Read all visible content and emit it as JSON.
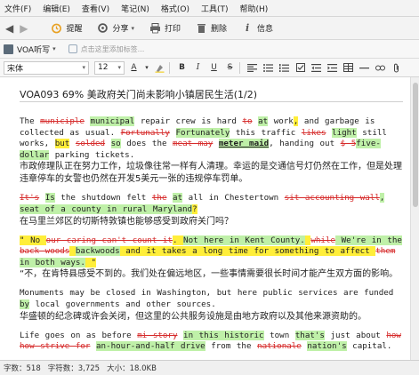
{
  "menu": [
    "文件(F)",
    "编辑(E)",
    "查看(V)",
    "笔记(N)",
    "格式(O)",
    "工具(T)",
    "帮助(H)"
  ],
  "toolbar": {
    "back": "◀",
    "forward": "▶",
    "remind": "提醒",
    "share": "分享",
    "share_arrow": "▾",
    "print": "打印",
    "delete": "删除",
    "info": "信息"
  },
  "notebook": {
    "name": "VOA听写",
    "arrow": "▾",
    "tag_placeholder": "点击这里添加标签..."
  },
  "format": {
    "font": "宋体",
    "size": "12",
    "color_btn": "A",
    "bold": "B",
    "italic": "I",
    "underline": "U",
    "strike": "S",
    "arrow": "▾"
  },
  "note": {
    "title": "VOA093 69% 美政府关门尚未影响小镇居民生活(1/2)",
    "paragraphs": [
      {
        "en": [
          {
            "t": "The ",
            "s": "n"
          },
          {
            "t": "municiple",
            "s": "del"
          },
          {
            "t": " ",
            "s": "n"
          },
          {
            "t": "municipal",
            "s": "hl"
          },
          {
            "t": " repair crew is hard ",
            "s": "n"
          },
          {
            "t": "to",
            "s": "del"
          },
          {
            "t": " ",
            "s": "n"
          },
          {
            "t": "at",
            "s": "hl"
          },
          {
            "t": " work",
            "s": "n"
          },
          {
            "t": ",",
            "s": "yl"
          },
          {
            "t": " and garbage is collected as usual. ",
            "s": "n"
          },
          {
            "t": "Fortunally",
            "s": "del"
          },
          {
            "t": " ",
            "s": "n"
          },
          {
            "t": "Fortunately",
            "s": "hl"
          },
          {
            "t": " this traffic ",
            "s": "n"
          },
          {
            "t": "likes",
            "s": "del"
          },
          {
            "t": " ",
            "s": "n"
          },
          {
            "t": "light",
            "s": "hl"
          },
          {
            "t": " still works, ",
            "s": "n"
          },
          {
            "t": "but",
            "s": "yl"
          },
          {
            "t": " ",
            "s": "n"
          },
          {
            "t": "solded",
            "s": "del"
          },
          {
            "t": " ",
            "s": "n"
          },
          {
            "t": "so",
            "s": "hl"
          },
          {
            "t": " does the ",
            "s": "n"
          },
          {
            "t": "meat may",
            "s": "del"
          },
          {
            "t": " ",
            "s": "n"
          },
          {
            "t": "meter maid",
            "s": "b"
          },
          {
            "t": ", handing out ",
            "s": "n"
          },
          {
            "t": "$ 5",
            "s": "del"
          },
          {
            "t": "five-dollar",
            "s": "hl"
          },
          {
            "t": " parking tickets.",
            "s": "n"
          }
        ],
        "cn": "市政修理队正在努力工作，垃圾像往常一样有人清理。幸运的是交通信号灯仍然在工作，但是处理违章停车的女警也仍然在开发5美元一张的违规停车罚单。"
      },
      {
        "en": [
          {
            "t": "It's",
            "s": "del"
          },
          {
            "t": " ",
            "s": "n"
          },
          {
            "t": "Is",
            "s": "hl"
          },
          {
            "t": " the shutdown felt ",
            "s": "n"
          },
          {
            "t": "the",
            "s": "del"
          },
          {
            "t": " ",
            "s": "n"
          },
          {
            "t": "at",
            "s": "hl"
          },
          {
            "t": " all in Chestertown ",
            "s": "n"
          },
          {
            "t": "sit accounting wall",
            "s": "del"
          },
          {
            "t": ", seat of a county in rural Maryland",
            "s": "hl"
          },
          {
            "t": "?",
            "s": "yl"
          }
        ],
        "cn": "在马里兰郊区的切斯特敦镇也能够感受到政府关门吗？"
      },
      {
        "en": [
          {
            "t": "\" No ",
            "s": "yl"
          },
          {
            "t": "our caring can't count it",
            "s": "del"
          },
          {
            "t": ". ",
            "s": "yl"
          },
          {
            "t": "Not here in Kent County.",
            "s": "hl"
          },
          {
            "t": " ",
            "s": "yl"
          },
          {
            "t": "while",
            "s": "del"
          },
          {
            "t": " We're in the ",
            "s": "hl"
          },
          {
            "t": "back woods",
            "s": "del"
          },
          {
            "t": " ",
            "s": "yl"
          },
          {
            "t": "backwoods",
            "s": "hl"
          },
          {
            "t": " and it takes a long time for something to affect ",
            "s": "yl"
          },
          {
            "t": "them",
            "s": "del"
          },
          {
            "t": " ",
            "s": "yl"
          },
          {
            "t": "in both ways.",
            "s": "hl"
          },
          {
            "t": " \"",
            "s": "yl"
          }
        ],
        "cn": "“不，在肯特县感受不到的。我们处在偏远地区，一些事情需要很长时间才能产生双方面的影响。"
      },
      {
        "en": [
          {
            "t": "Monuments may be closed in Washington, but here public services are funded ",
            "s": "n"
          },
          {
            "t": "by",
            "s": "hl"
          },
          {
            "t": " local governments and other sources.",
            "s": "n"
          }
        ],
        "cn": "华盛顿的纪念碑或许会关闭，但这里的公共服务设施是由地方政府以及其他来源资助的。"
      },
      {
        "en": [
          {
            "t": "Life goes on as before ",
            "s": "n"
          },
          {
            "t": "mi story",
            "s": "del"
          },
          {
            "t": " ",
            "s": "n"
          },
          {
            "t": "in this historic",
            "s": "hl"
          },
          {
            "t": " town ",
            "s": "n"
          },
          {
            "t": "that's",
            "s": "hl"
          },
          {
            "t": " just about ",
            "s": "n"
          },
          {
            "t": "how how strive for",
            "s": "del"
          },
          {
            "t": " ",
            "s": "n"
          },
          {
            "t": "an-hour-and-half drive",
            "s": "hl"
          },
          {
            "t": " from the ",
            "s": "n"
          },
          {
            "t": "nationale",
            "s": "del"
          },
          {
            "t": " ",
            "s": "n"
          },
          {
            "t": "nation's",
            "s": "hl"
          },
          {
            "t": " capital.",
            "s": "n"
          }
        ],
        "cn": ""
      }
    ]
  },
  "status": {
    "words": "字数：518",
    "chars": "字符数：3,725",
    "size": "大小：18.0KB"
  },
  "colors": {
    "deleted": "#d62c2c",
    "correct_highlight": "#bff0a8",
    "marker_highlight": "#ffee3a"
  }
}
